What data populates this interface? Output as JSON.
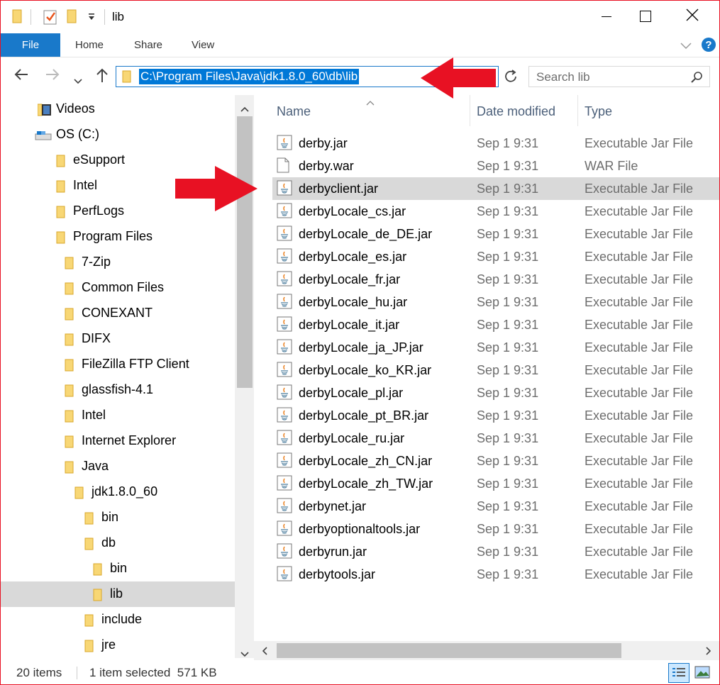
{
  "window": {
    "title": "lib",
    "controls": {
      "minimize_icon": "minimize-icon",
      "maximize_icon": "maximize-icon",
      "close_icon": "close-icon"
    }
  },
  "ribbon": {
    "tabs": [
      {
        "label": "File"
      },
      {
        "label": "Home"
      },
      {
        "label": "Share"
      },
      {
        "label": "View"
      }
    ]
  },
  "address": {
    "path": "C:\\Program Files\\Java\\jdk1.8.0_60\\db\\lib",
    "search_placeholder": "Search lib"
  },
  "tree": [
    {
      "label": "Videos",
      "indent": 0,
      "icon": "videos-folder-icon"
    },
    {
      "label": "OS (C:)",
      "indent": 0,
      "icon": "drive-icon"
    },
    {
      "label": "eSupport",
      "indent": 1,
      "icon": "folder-icon"
    },
    {
      "label": "Intel",
      "indent": 1,
      "icon": "folder-icon"
    },
    {
      "label": "PerfLogs",
      "indent": 1,
      "icon": "folder-icon"
    },
    {
      "label": "Program Files",
      "indent": 1,
      "icon": "folder-icon"
    },
    {
      "label": "7-Zip",
      "indent": 2,
      "icon": "folder-icon"
    },
    {
      "label": "Common Files",
      "indent": 2,
      "icon": "folder-icon"
    },
    {
      "label": "CONEXANT",
      "indent": 2,
      "icon": "folder-icon"
    },
    {
      "label": "DIFX",
      "indent": 2,
      "icon": "folder-icon"
    },
    {
      "label": "FileZilla FTP Client",
      "indent": 2,
      "icon": "folder-icon"
    },
    {
      "label": "glassfish-4.1",
      "indent": 2,
      "icon": "folder-icon"
    },
    {
      "label": "Intel",
      "indent": 2,
      "icon": "folder-icon"
    },
    {
      "label": "Internet Explorer",
      "indent": 2,
      "icon": "folder-icon"
    },
    {
      "label": "Java",
      "indent": 2,
      "icon": "folder-icon"
    },
    {
      "label": "jdk1.8.0_60",
      "indent": 3,
      "icon": "folder-icon"
    },
    {
      "label": "bin",
      "indent": 4,
      "icon": "folder-icon"
    },
    {
      "label": "db",
      "indent": 4,
      "icon": "folder-icon"
    },
    {
      "label": "bin",
      "indent": 5,
      "icon": "folder-icon"
    },
    {
      "label": "lib",
      "indent": 5,
      "icon": "folder-icon",
      "selected": true
    },
    {
      "label": "include",
      "indent": 4,
      "icon": "folder-icon"
    },
    {
      "label": "jre",
      "indent": 4,
      "icon": "folder-icon"
    }
  ],
  "columns": {
    "name": "Name",
    "date": "Date modified",
    "type": "Type"
  },
  "files": [
    {
      "name": "derby.jar",
      "date": "Sep 1 9:31",
      "type": "Executable Jar File",
      "icon": "jar-icon"
    },
    {
      "name": "derby.war",
      "date": "Sep 1 9:31",
      "type": "WAR File",
      "icon": "file-icon"
    },
    {
      "name": "derbyclient.jar",
      "date": "Sep 1 9:31",
      "type": "Executable Jar File",
      "icon": "jar-icon",
      "selected": true
    },
    {
      "name": "derbyLocale_cs.jar",
      "date": "Sep 1 9:31",
      "type": "Executable Jar File",
      "icon": "jar-icon"
    },
    {
      "name": "derbyLocale_de_DE.jar",
      "date": "Sep 1 9:31",
      "type": "Executable Jar File",
      "icon": "jar-icon"
    },
    {
      "name": "derbyLocale_es.jar",
      "date": "Sep 1 9:31",
      "type": "Executable Jar File",
      "icon": "jar-icon"
    },
    {
      "name": "derbyLocale_fr.jar",
      "date": "Sep 1 9:31",
      "type": "Executable Jar File",
      "icon": "jar-icon"
    },
    {
      "name": "derbyLocale_hu.jar",
      "date": "Sep 1 9:31",
      "type": "Executable Jar File",
      "icon": "jar-icon"
    },
    {
      "name": "derbyLocale_it.jar",
      "date": "Sep 1 9:31",
      "type": "Executable Jar File",
      "icon": "jar-icon"
    },
    {
      "name": "derbyLocale_ja_JP.jar",
      "date": "Sep 1 9:31",
      "type": "Executable Jar File",
      "icon": "jar-icon"
    },
    {
      "name": "derbyLocale_ko_KR.jar",
      "date": "Sep 1 9:31",
      "type": "Executable Jar File",
      "icon": "jar-icon"
    },
    {
      "name": "derbyLocale_pl.jar",
      "date": "Sep 1 9:31",
      "type": "Executable Jar File",
      "icon": "jar-icon"
    },
    {
      "name": "derbyLocale_pt_BR.jar",
      "date": "Sep 1 9:31",
      "type": "Executable Jar File",
      "icon": "jar-icon"
    },
    {
      "name": "derbyLocale_ru.jar",
      "date": "Sep 1 9:31",
      "type": "Executable Jar File",
      "icon": "jar-icon"
    },
    {
      "name": "derbyLocale_zh_CN.jar",
      "date": "Sep 1 9:31",
      "type": "Executable Jar File",
      "icon": "jar-icon"
    },
    {
      "name": "derbyLocale_zh_TW.jar",
      "date": "Sep 1 9:31",
      "type": "Executable Jar File",
      "icon": "jar-icon"
    },
    {
      "name": "derbynet.jar",
      "date": "Sep 1 9:31",
      "type": "Executable Jar File",
      "icon": "jar-icon"
    },
    {
      "name": "derbyoptionaltools.jar",
      "date": "Sep 1 9:31",
      "type": "Executable Jar File",
      "icon": "jar-icon"
    },
    {
      "name": "derbyrun.jar",
      "date": "Sep 1 9:31",
      "type": "Executable Jar File",
      "icon": "jar-icon"
    },
    {
      "name": "derbytools.jar",
      "date": "Sep 1 9:31",
      "type": "Executable Jar File",
      "icon": "jar-icon"
    }
  ],
  "status": {
    "item_count": "20 items",
    "selection": "1 item selected  571 KB"
  },
  "colors": {
    "accent": "#1979ca",
    "selection_highlight": "#0078d7",
    "row_highlight": "#d9d9d9",
    "annotation_arrow": "#e81123",
    "folder": "#f8d775"
  }
}
